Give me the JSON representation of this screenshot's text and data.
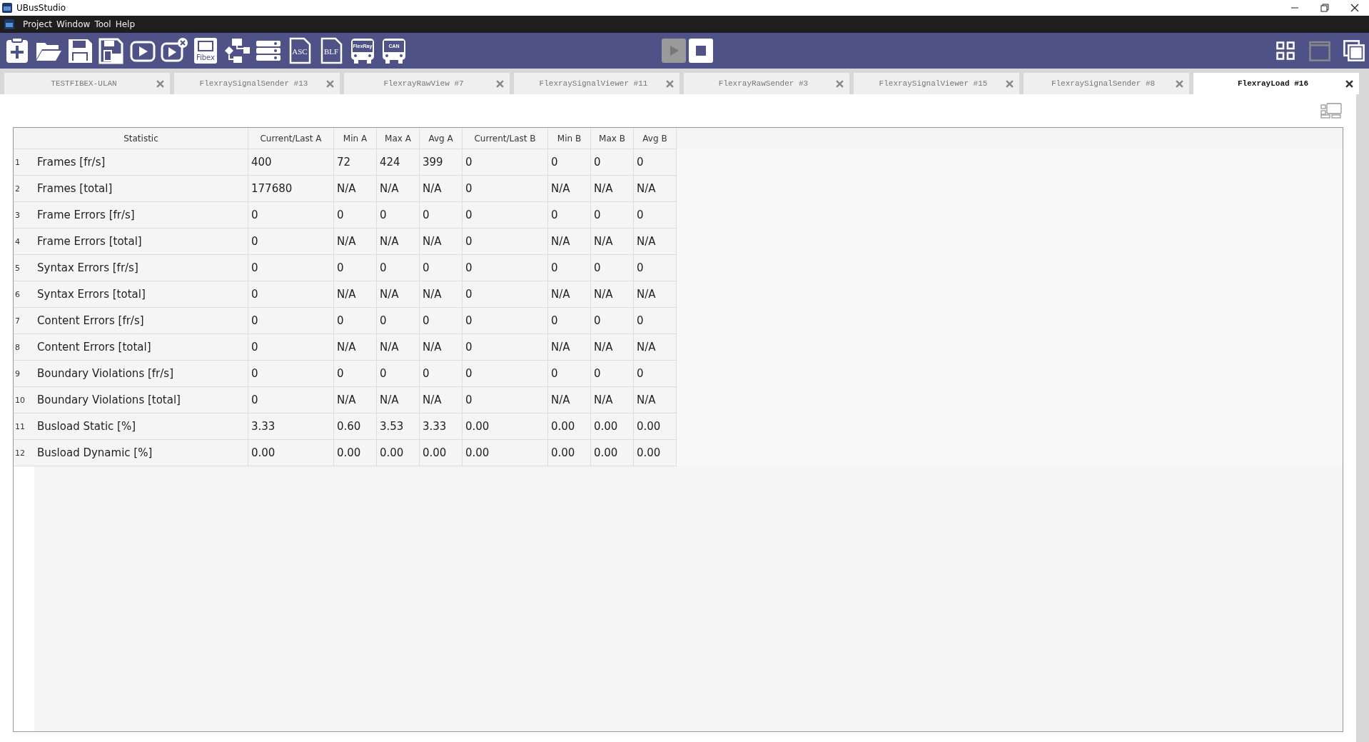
{
  "window": {
    "title": "UBusStudio"
  },
  "menu": [
    {
      "label": "Project"
    },
    {
      "label": "Window"
    },
    {
      "label": "Tool"
    },
    {
      "label": "Help"
    }
  ],
  "toolbar": {
    "buttons": [
      {
        "kind": "new"
      },
      {
        "kind": "open"
      },
      {
        "kind": "save"
      },
      {
        "kind": "save-as"
      },
      {
        "kind": "run"
      },
      {
        "kind": "stop-run"
      },
      {
        "kind": "doc",
        "label": "Fibex"
      },
      {
        "kind": "flow"
      },
      {
        "kind": "list"
      },
      {
        "kind": "file",
        "label": "ASC"
      },
      {
        "kind": "file",
        "label": "BLF"
      },
      {
        "kind": "bus",
        "label": "FlexRay"
      },
      {
        "kind": "bus",
        "label": "CAN"
      }
    ],
    "controls": [
      {
        "kind": "play",
        "disabled": true
      },
      {
        "kind": "stop",
        "disabled": false
      }
    ],
    "layout": [
      {
        "kind": "grid",
        "disabled": false
      },
      {
        "kind": "window",
        "disabled": true
      },
      {
        "kind": "cascade",
        "disabled": false
      }
    ]
  },
  "tabs": [
    {
      "label": "TESTFIBEX-ULAN",
      "selected": false
    },
    {
      "label": "FlexraySignalSender #13",
      "selected": false
    },
    {
      "label": "FlexrayRawView #7",
      "selected": false
    },
    {
      "label": "FlexraySignalViewer #11",
      "selected": false
    },
    {
      "label": "FlexrayRawSender #3",
      "selected": false
    },
    {
      "label": "FlexraySignalViewer #15",
      "selected": false
    },
    {
      "label": "FlexraySignalSender #8",
      "selected": false
    },
    {
      "label": "FlexrayLoad #16",
      "selected": true
    }
  ],
  "table": {
    "columns": [
      "Statistic",
      "Current/Last A",
      "Min A",
      "Max A",
      "Avg A",
      "Current/Last B",
      "Min B",
      "Max B",
      "Avg B"
    ],
    "rows": [
      {
        "index": "1",
        "cells": [
          "Frames [fr/s]",
          "400",
          "72",
          "424",
          "399",
          "0",
          "0",
          "0",
          "0"
        ]
      },
      {
        "index": "2",
        "cells": [
          "Frames [total]",
          "177680",
          "N/A",
          "N/A",
          "N/A",
          "0",
          "N/A",
          "N/A",
          "N/A"
        ]
      },
      {
        "index": "3",
        "cells": [
          "Frame Errors [fr/s]",
          "0",
          "0",
          "0",
          "0",
          "0",
          "0",
          "0",
          "0"
        ]
      },
      {
        "index": "4",
        "cells": [
          "Frame Errors [total]",
          "0",
          "N/A",
          "N/A",
          "N/A",
          "0",
          "N/A",
          "N/A",
          "N/A"
        ]
      },
      {
        "index": "5",
        "cells": [
          "Syntax Errors [fr/s]",
          "0",
          "0",
          "0",
          "0",
          "0",
          "0",
          "0",
          "0"
        ]
      },
      {
        "index": "6",
        "cells": [
          "Syntax Errors [total]",
          "0",
          "N/A",
          "N/A",
          "N/A",
          "0",
          "N/A",
          "N/A",
          "N/A"
        ]
      },
      {
        "index": "7",
        "cells": [
          "Content Errors [fr/s]",
          "0",
          "0",
          "0",
          "0",
          "0",
          "0",
          "0",
          "0"
        ]
      },
      {
        "index": "8",
        "cells": [
          "Content Errors [total]",
          "0",
          "N/A",
          "N/A",
          "N/A",
          "0",
          "N/A",
          "N/A",
          "N/A"
        ]
      },
      {
        "index": "9",
        "cells": [
          "Boundary Violations [fr/s]",
          "0",
          "0",
          "0",
          "0",
          "0",
          "0",
          "0",
          "0"
        ]
      },
      {
        "index": "10",
        "cells": [
          "Boundary Violations [total]",
          "0",
          "N/A",
          "N/A",
          "N/A",
          "0",
          "N/A",
          "N/A",
          "N/A"
        ]
      },
      {
        "index": "11",
        "cells": [
          "Busload Static [%]",
          "3.33",
          "0.60",
          "3.53",
          "3.33",
          "0.00",
          "0.00",
          "0.00",
          "0.00"
        ]
      },
      {
        "index": "12",
        "cells": [
          "Busload Dynamic [%]",
          "0.00",
          "0.00",
          "0.00",
          "0.00",
          "0.00",
          "0.00",
          "0.00",
          "0.00"
        ]
      }
    ]
  }
}
